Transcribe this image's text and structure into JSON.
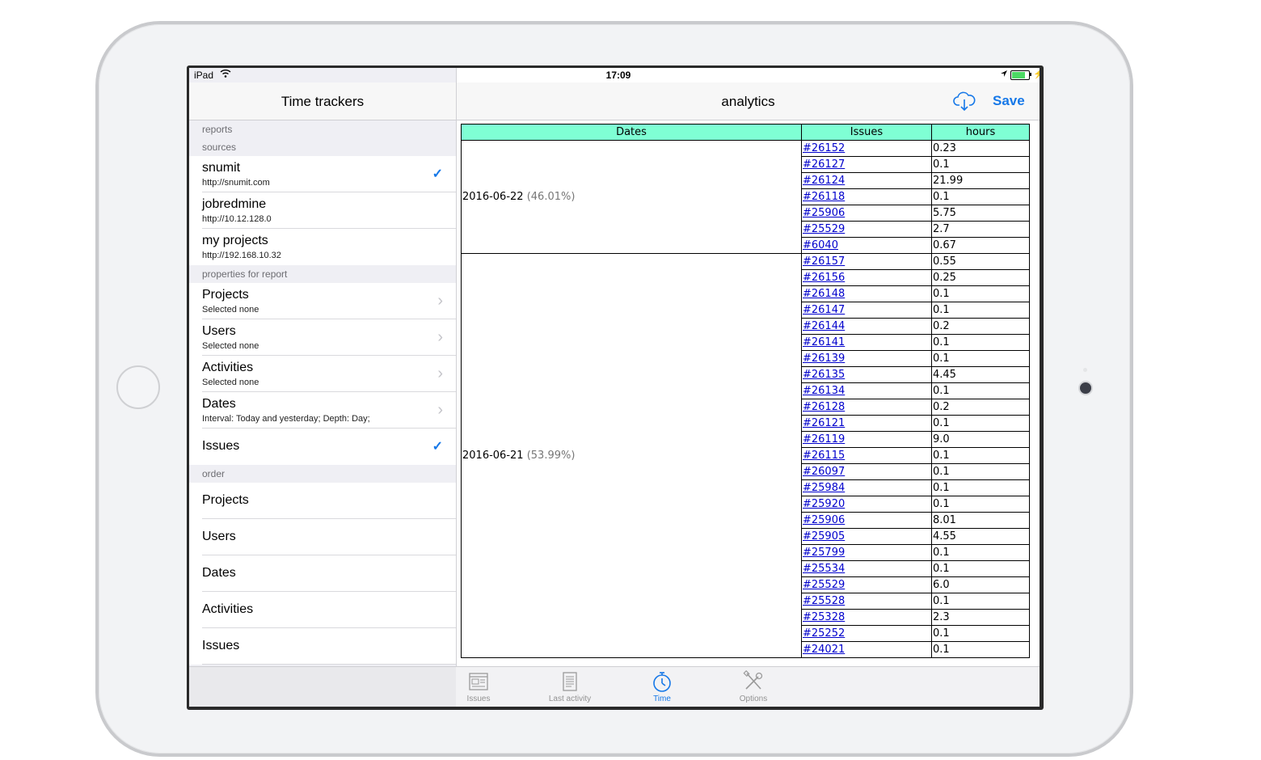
{
  "status_bar": {
    "carrier": "iPad",
    "time": "17:09"
  },
  "master": {
    "title": "Time trackers",
    "sections": {
      "reports": "reports",
      "sources": "sources",
      "properties": "properties for report",
      "order": "order"
    },
    "sources": [
      {
        "name": "snumit",
        "url": "http://snumit.com"
      },
      {
        "name": "jobredmine",
        "url": "http://10.12.128.0"
      },
      {
        "name": "my projects",
        "url": "http://192.168.10.32"
      }
    ],
    "properties": [
      {
        "name": "Projects",
        "value": "Selected none"
      },
      {
        "name": "Users",
        "value": "Selected none"
      },
      {
        "name": "Activities",
        "value": "Selected none"
      },
      {
        "name": "Dates",
        "value": "Interval: Today and yesterday; Depth: Day;"
      },
      {
        "name": "Issues"
      }
    ],
    "order": [
      "Projects",
      "Users",
      "Dates",
      "Activities",
      "Issues"
    ]
  },
  "detail": {
    "title": "analytics",
    "save_label": "Save",
    "cloud_icon": "cloud-download-icon",
    "table": {
      "headers": [
        "Dates",
        "Issues",
        "hours"
      ],
      "groups": [
        {
          "date": "2016-06-22",
          "percent": "(46.01%)",
          "rows": [
            [
              "#26152",
              "0.23"
            ],
            [
              "#26127",
              "0.1"
            ],
            [
              "#26124",
              "21.99"
            ],
            [
              "#26118",
              "0.1"
            ],
            [
              "#25906",
              "5.75"
            ],
            [
              "#25529",
              "2.7"
            ],
            [
              "#6040",
              "0.67"
            ]
          ]
        },
        {
          "date": "2016-06-21",
          "percent": "(53.99%)",
          "rows": [
            [
              "#26157",
              "0.55"
            ],
            [
              "#26156",
              "0.25"
            ],
            [
              "#26148",
              "0.1"
            ],
            [
              "#26147",
              "0.1"
            ],
            [
              "#26144",
              "0.2"
            ],
            [
              "#26141",
              "0.1"
            ],
            [
              "#26139",
              "0.1"
            ],
            [
              "#26135",
              "4.45"
            ],
            [
              "#26134",
              "0.1"
            ],
            [
              "#26128",
              "0.2"
            ],
            [
              "#26121",
              "0.1"
            ],
            [
              "#26119",
              "9.0"
            ],
            [
              "#26115",
              "0.1"
            ],
            [
              "#26097",
              "0.1"
            ],
            [
              "#25984",
              "0.1"
            ],
            [
              "#25920",
              "0.1"
            ],
            [
              "#25906",
              "8.01"
            ],
            [
              "#25905",
              "4.55"
            ],
            [
              "#25799",
              "0.1"
            ],
            [
              "#25534",
              "0.1"
            ],
            [
              "#25529",
              "6.0"
            ],
            [
              "#25528",
              "0.1"
            ],
            [
              "#25328",
              "2.3"
            ],
            [
              "#25252",
              "0.1"
            ],
            [
              "#24021",
              "0.1"
            ]
          ]
        }
      ]
    }
  },
  "tabbar": {
    "tabs": [
      {
        "label": "Issues",
        "icon": "issues-icon",
        "active": false
      },
      {
        "label": "Last activity",
        "icon": "document-icon",
        "active": false
      },
      {
        "label": "Time",
        "icon": "stopwatch-icon",
        "active": true
      },
      {
        "label": "Options",
        "icon": "tools-icon",
        "active": false
      }
    ]
  },
  "colors": {
    "accent": "#1678e8",
    "table_header": "#7fffd4",
    "link": "#0000cc"
  }
}
